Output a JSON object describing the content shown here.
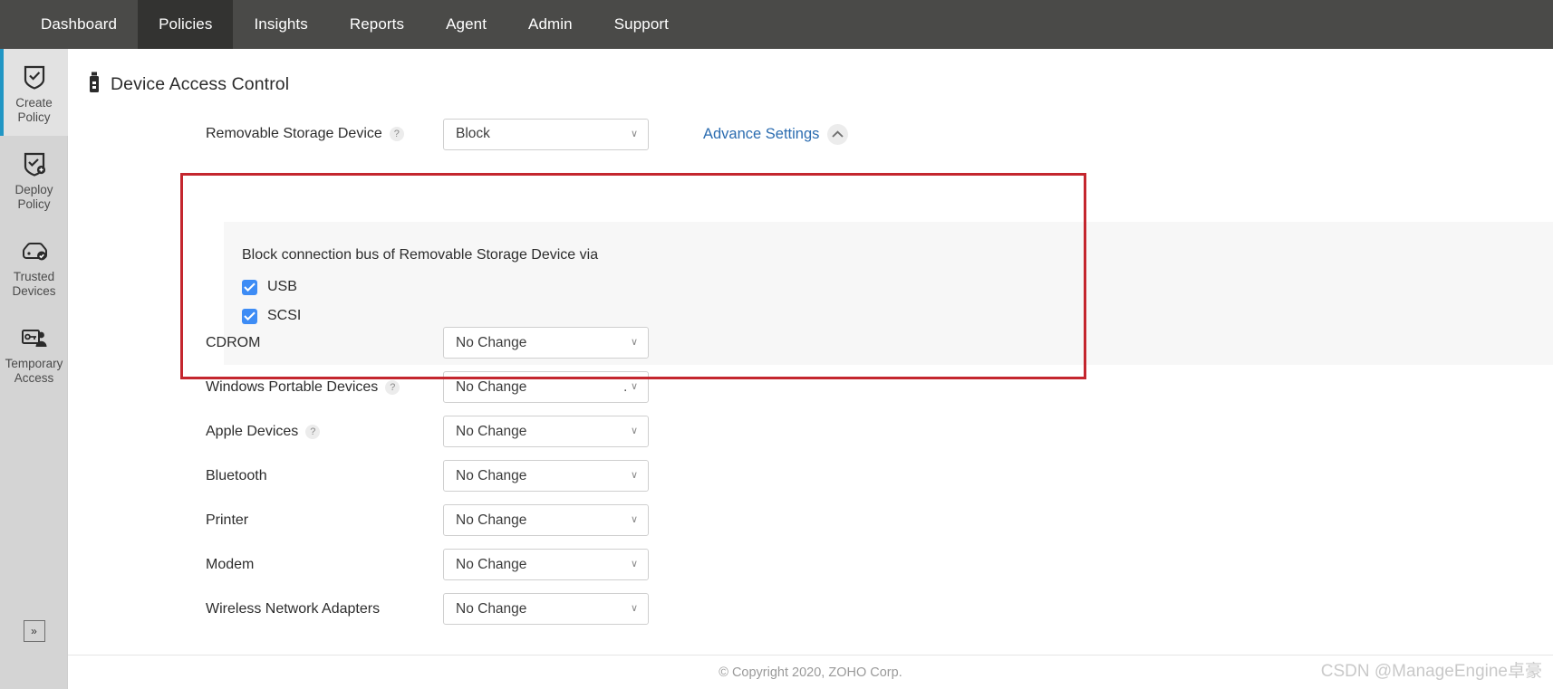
{
  "nav": {
    "items": [
      {
        "label": "Dashboard",
        "active": false
      },
      {
        "label": "Policies",
        "active": true
      },
      {
        "label": "Insights",
        "active": false
      },
      {
        "label": "Reports",
        "active": false
      },
      {
        "label": "Agent",
        "active": false
      },
      {
        "label": "Admin",
        "active": false
      },
      {
        "label": "Support",
        "active": false
      }
    ]
  },
  "sidebar": {
    "items": [
      {
        "label": "Create\nPolicy",
        "icon": "shield-check-icon",
        "active": true
      },
      {
        "label": "Deploy\nPolicy",
        "icon": "shield-check-plus-icon",
        "active": false
      },
      {
        "label": "Trusted\nDevices",
        "icon": "hard-drive-check-icon",
        "active": false
      },
      {
        "label": "Temporary\nAccess",
        "icon": "access-card-user-icon",
        "active": false
      }
    ],
    "collapse_glyph": "»"
  },
  "page": {
    "title": "Device Access Control",
    "title_icon": "usb-drive-icon"
  },
  "highlighted_group": {
    "label": "Removable Storage Device",
    "help_icon": "question-mark-icon",
    "value": "Block",
    "advance_settings_label": "Advance Settings",
    "advance_toggle_icon": "chevron-up-icon",
    "panel": {
      "title": "Block connection bus of Removable Storage Device via",
      "checkboxes": [
        {
          "label": "USB",
          "checked": true
        },
        {
          "label": "SCSI",
          "checked": true
        }
      ]
    },
    "highlight_color": "#c4262e"
  },
  "device_rows": [
    {
      "label": "CDROM",
      "help": false,
      "value": "No Change",
      "stray_dot": ""
    },
    {
      "label": "Windows Portable Devices",
      "help": true,
      "value": "No Change",
      "stray_dot": "."
    },
    {
      "label": "Apple Devices",
      "help": true,
      "value": "No Change",
      "stray_dot": ""
    },
    {
      "label": "Bluetooth",
      "help": false,
      "value": "No Change",
      "stray_dot": ""
    },
    {
      "label": "Printer",
      "help": false,
      "value": "No Change",
      "stray_dot": ""
    },
    {
      "label": "Modem",
      "help": false,
      "value": "No Change",
      "stray_dot": ""
    },
    {
      "label": "Wireless Network Adapters",
      "help": false,
      "value": "No Change",
      "stray_dot": ""
    }
  ],
  "select_chevron": "∨",
  "footer": {
    "text": "© Copyright 2020, ZOHO Corp."
  },
  "watermark": {
    "text": "CSDN @ManageEngine卓豪"
  },
  "colors": {
    "nav_bg": "#4a4a48",
    "nav_active_bg": "#333331",
    "sidebar_bg": "#d4d4d4",
    "sidebar_active_accent": "#2196c4",
    "link_blue": "#2b6cb0",
    "checkbox_blue": "#3d8cf5",
    "highlight_red": "#c4262e",
    "panel_gray": "#f7f7f7"
  }
}
